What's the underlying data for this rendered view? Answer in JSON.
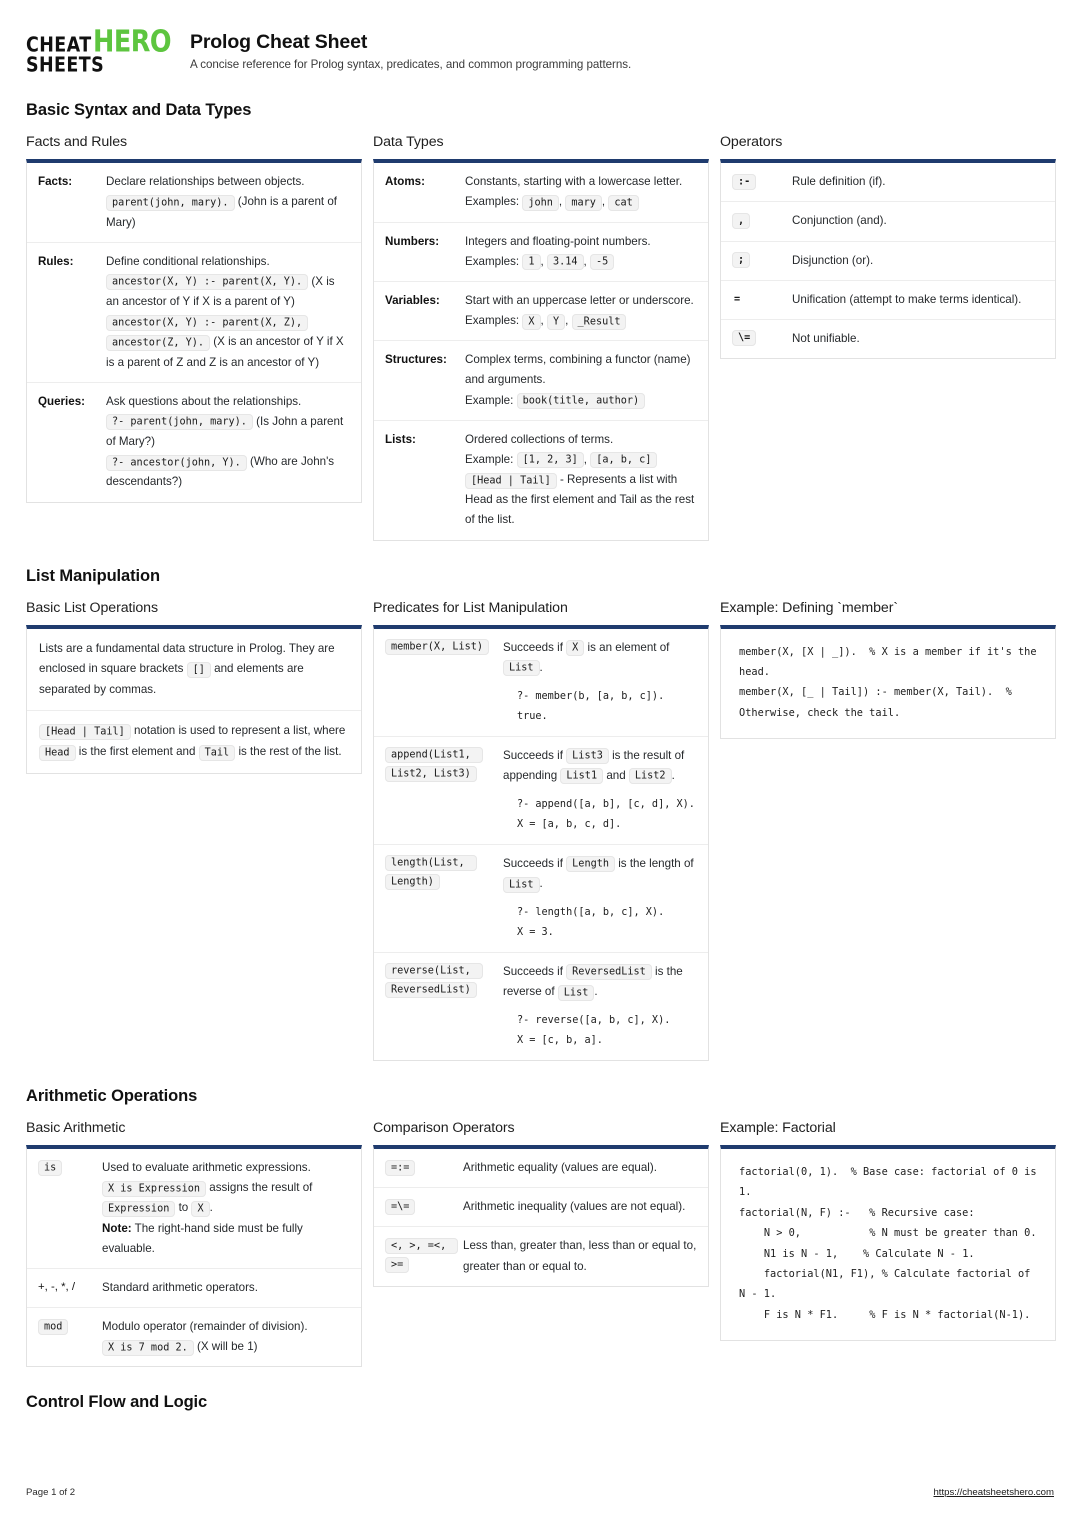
{
  "brand": {
    "line1": "CHEAT",
    "line2": "SHEETS",
    "hero": "HERO",
    "hero_color": "#5dc53f",
    "accent_color": "#1f3b6e"
  },
  "header": {
    "title": "Prolog Cheat Sheet",
    "subtitle": "A concise reference for Prolog syntax, predicates, and common programming patterns."
  },
  "sections": {
    "basic_syntax": "Basic Syntax and Data Types",
    "list_manipulation": "List Manipulation",
    "arithmetic": "Arithmetic Operations",
    "control_flow": "Control Flow and Logic"
  },
  "facts_and_rules": {
    "title": "Facts and Rules",
    "rows": [
      {
        "term": "Facts:",
        "desc_1": "Declare relationships between objects.",
        "code_1": "parent(john, mary).",
        "tail_1": "(John is a parent of Mary)"
      },
      {
        "term": "Rules:",
        "desc_1": "Define conditional relationships.",
        "code_1": "ancestor(X, Y) :- parent(X, Y).",
        "tail_1": "(X is an ancestor of Y if X is a parent of Y)",
        "code_2": "ancestor(X, Y) :- parent(X, Z),",
        "code_3": "ancestor(Z, Y).",
        "tail_2": "(X is an ancestor of Y if X is a parent of Z and Z is an ancestor of Y)"
      },
      {
        "term": "Queries:",
        "desc_1": "Ask questions about the relationships.",
        "code_1": "?- parent(john, mary).",
        "tail_1": "(Is John a parent of Mary?)",
        "code_2": "?- ancestor(john, Y).",
        "tail_2": "(Who are John's descendants?)"
      }
    ]
  },
  "data_types": {
    "title": "Data Types",
    "rows": [
      {
        "term": "Atoms:",
        "desc": "Constants, starting with a lowercase letter.",
        "example_label": "Examples:",
        "codes": [
          "john",
          "mary",
          "cat"
        ]
      },
      {
        "term": "Numbers:",
        "desc": "Integers and floating-point numbers.",
        "example_label": "Examples:",
        "codes": [
          "1",
          "3.14",
          "-5"
        ]
      },
      {
        "term": "Variables:",
        "desc": "Start with an uppercase letter or underscore.",
        "example_label": "Examples:",
        "codes": [
          "X",
          "Y",
          "_Result"
        ]
      },
      {
        "term": "Structures:",
        "desc": "Complex terms, combining a functor (name) and arguments.",
        "example_label": "Example:",
        "codes": [
          "book(title, author)"
        ]
      },
      {
        "term": "Lists:",
        "desc": "Ordered collections of terms.",
        "example_label": "Example:",
        "codes": [
          "[1, 2, 3]",
          "[a, b, c]"
        ],
        "extra_code": "[Head | Tail]",
        "extra_text": "- Represents a list with Head as the first element and Tail as the rest of the list."
      }
    ]
  },
  "operators": {
    "title": "Operators",
    "rows": [
      {
        "op": ":-",
        "badge": true,
        "desc": "Rule definition (if)."
      },
      {
        "op": ",",
        "badge": true,
        "desc": "Conjunction (and)."
      },
      {
        "op": ";",
        "badge": true,
        "desc": "Disjunction (or)."
      },
      {
        "op": "=",
        "badge": false,
        "desc": "Unification (attempt to make terms identical)."
      },
      {
        "op": "\\=",
        "badge": true,
        "desc": "Not unifiable."
      }
    ]
  },
  "basic_list_operations": {
    "title": "Basic List Operations",
    "blocks": [
      {
        "part_1": "Lists are a fundamental data structure in Prolog. They are enclosed in square brackets",
        "code_1": "[]",
        "part_2": "and elements are separated by commas."
      },
      {
        "code_1": "[Head | Tail]",
        "part_1": "notation is used to represent a list, where",
        "code_2": "Head",
        "part_2": "is the first element and",
        "code_3": "Tail",
        "part_3": "is the rest of the list."
      }
    ]
  },
  "list_predicates": {
    "title": "Predicates for List Manipulation",
    "rows": [
      {
        "signature": "member(X, List)",
        "desc_pre": "Succeeds if",
        "code_a": "X",
        "desc_mid": "is an element of",
        "code_b": "List",
        "desc_post": ".",
        "sample": "?- member(b, [a, b, c]).\ntrue."
      },
      {
        "signature": "append(List1, List2, List3)",
        "desc_pre": "Succeeds if",
        "code_a": "List3",
        "desc_mid": "is the result of appending",
        "code_b": "List1",
        "desc_mid2": "and",
        "code_c": "List2",
        "desc_post": ".",
        "sample": "?- append([a, b], [c, d], X).\nX = [a, b, c, d]."
      },
      {
        "signature": "length(List, Length)",
        "desc_pre": "Succeeds if",
        "code_a": "Length",
        "desc_mid": "is the length of",
        "code_b": "List",
        "desc_post": ".",
        "sample": "?- length([a, b, c], X).\nX = 3."
      },
      {
        "signature": "reverse(List, ReversedList)",
        "desc_pre": "Succeeds if",
        "code_a": "ReversedList",
        "desc_mid": "is the reverse of",
        "code_b": "List",
        "desc_post": ".",
        "sample": "?- reverse([a, b, c], X).\nX = [c, b, a]."
      }
    ]
  },
  "example_member": {
    "title": "Example: Defining `member`",
    "code": "member(X, [X | _]).  % X is a member if it's the head.\nmember(X, [_ | Tail]) :- member(X, Tail).  % Otherwise, check the tail."
  },
  "basic_arithmetic": {
    "title": "Basic Arithmetic",
    "rows": [
      {
        "op": "is",
        "badge": true,
        "desc_1": "Used to evaluate arithmetic expressions.",
        "code_1": "X is Expression",
        "desc_2": "assigns the result of",
        "code_2": "Expression",
        "desc_3": "to",
        "code_3": "X",
        "desc_4": ".",
        "note_label": "Note:",
        "note_text": "The right-hand side must be fully evaluable."
      },
      {
        "op": "+, -, *, /",
        "badge": false,
        "desc_1": "Standard arithmetic operators."
      },
      {
        "op": "mod",
        "badge": true,
        "desc_1": "Modulo operator (remainder of division).",
        "code_1": "X is 7 mod 2.",
        "desc_2": "(X will be 1)"
      }
    ]
  },
  "comparison_operators": {
    "title": "Comparison Operators",
    "rows": [
      {
        "op": "=:=",
        "desc": "Arithmetic equality (values are equal)."
      },
      {
        "op": "=\\=",
        "desc": "Arithmetic inequality (values are not equal)."
      },
      {
        "op": "<, >, =<, >=",
        "desc": "Less than, greater than, less than or equal to, greater than or equal to."
      }
    ]
  },
  "example_factorial": {
    "title": "Example: Factorial",
    "code": "factorial(0, 1).  % Base case: factorial of 0 is 1.\nfactorial(N, F) :-   % Recursive case:\n    N > 0,           % N must be greater than 0.\n    N1 is N - 1,    % Calculate N - 1.\n    factorial(N1, F1), % Calculate factorial of N - 1.\n    F is N * F1.     % F is N * factorial(N-1)."
  },
  "footer": {
    "page": "Page 1 of 2",
    "url": "https://cheatsheetshero.com"
  }
}
